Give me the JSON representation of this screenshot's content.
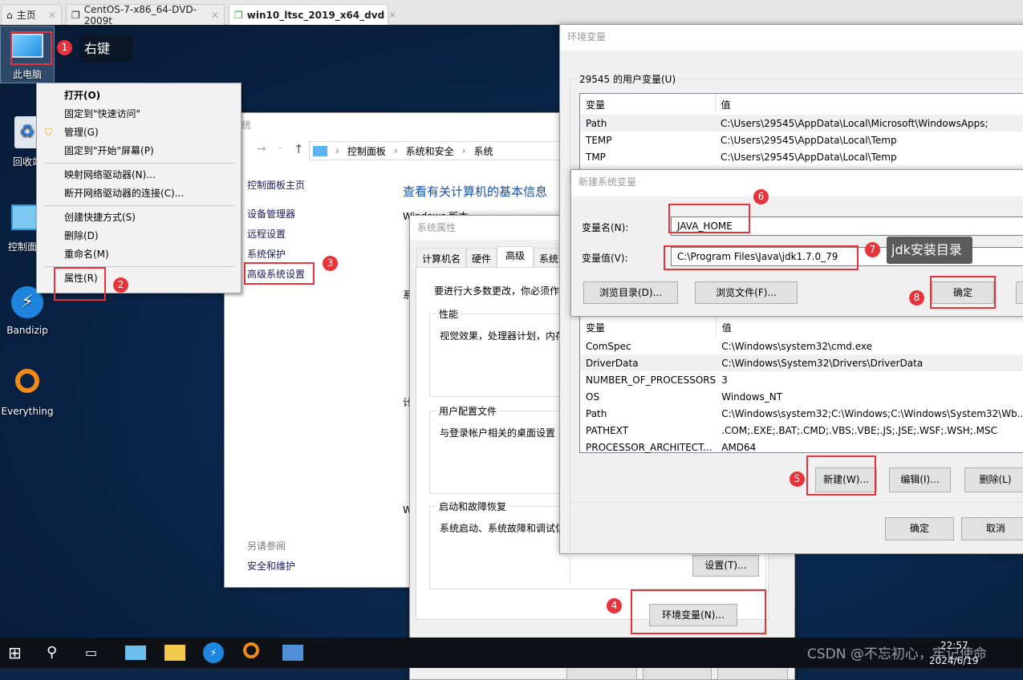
{
  "browser_tabs": [
    {
      "label": "主页",
      "icon": "home-icon"
    },
    {
      "label": "CentOS-7-x86_64-DVD-2009t",
      "icon": "vm-icon"
    },
    {
      "label": "win10_ltsc_2019_x64_dvd",
      "icon": "vm-running-icon",
      "active": true
    }
  ],
  "desktop_icons": [
    {
      "label": "此电脑",
      "icon": "computer-icon"
    },
    {
      "label": "回收站",
      "icon": "recycle-bin-icon"
    },
    {
      "label": "控制面板",
      "icon": "control-panel-icon"
    },
    {
      "label": "Bandizip",
      "icon": "bandizip-icon"
    },
    {
      "label": "Everything",
      "icon": "everything-icon"
    }
  ],
  "annotations": {
    "1": "1",
    "2": "2",
    "3": "3",
    "4": "4",
    "5": "5",
    "6": "6",
    "7": "7",
    "8": "8",
    "right_click_tip": "右键",
    "jdk_tip": "jdk安装目录",
    "color": "#e8333a"
  },
  "context_menu": {
    "items": [
      "打开(O)",
      "固定到\"快速访问\"",
      "管理(G)",
      "固定到\"开始\"屏幕(P)",
      "映射网络驱动器(N)...",
      "断开网络驱动器的连接(C)...",
      "创建快捷方式(S)",
      "删除(D)",
      "重命名(M)",
      "属性(R)"
    ]
  },
  "system_window": {
    "title": "系统",
    "breadcrumb": [
      "控制面板",
      "系统和安全",
      "系统"
    ],
    "sidebar": [
      "控制面板主页",
      "设备管理器",
      "远程设置",
      "系统保护",
      "高级系统设置"
    ],
    "heading": "查看有关计算机的基本信息",
    "windows_edition": "Windows 版本",
    "partial_labels": [
      "系",
      "计",
      "W"
    ],
    "see_also": "另请参阅",
    "see_also_link": "安全和维护"
  },
  "system_properties": {
    "title": "系统属性",
    "tabs": [
      "计算机名",
      "硬件",
      "高级",
      "系统"
    ],
    "active_tab": "高级",
    "notice": "要进行大多数更改，你必须作",
    "performance": {
      "label": "性能",
      "desc": "视觉效果，处理器计划，内存"
    },
    "user_profiles": {
      "label": "用户配置文件",
      "desc": "与登录帐户相关的桌面设置"
    },
    "startup": {
      "label": "启动和故障恢复",
      "desc": "系统启动、系统故障和调试信",
      "settings_button": "设置(T)..."
    },
    "env_button": "环境变量(N)..."
  },
  "env_dialog": {
    "title": "环境变量",
    "user_group": "29545 的用户变量(U)",
    "columns": [
      "变量",
      "值"
    ],
    "user_vars": [
      [
        "Path",
        "C:\\Users\\29545\\AppData\\Local\\Microsoft\\WindowsApps;"
      ],
      [
        "TEMP",
        "C:\\Users\\29545\\AppData\\Local\\Temp"
      ],
      [
        "TMP",
        "C:\\Users\\29545\\AppData\\Local\\Temp"
      ]
    ],
    "system_vars": [
      [
        "ComSpec",
        "C:\\Windows\\system32\\cmd.exe"
      ],
      [
        "DriverData",
        "C:\\Windows\\System32\\Drivers\\DriverData"
      ],
      [
        "NUMBER_OF_PROCESSORS",
        "3"
      ],
      [
        "OS",
        "Windows_NT"
      ],
      [
        "Path",
        "C:\\Windows\\system32;C:\\Windows;C:\\Windows\\System32\\Wb..."
      ],
      [
        "PATHEXT",
        ".COM;.EXE;.BAT;.CMD;.VBS;.VBE;.JS;.JSE;.WSF;.WSH;.MSC"
      ],
      [
        "PROCESSOR_ARCHITECT...",
        "AMD64"
      ]
    ],
    "new_button": "新建(W)...",
    "edit_button": "编辑(I)...",
    "delete_button": "删除(L)",
    "ok_button": "确定",
    "cancel_button": "取消"
  },
  "new_var_dialog": {
    "title": "新建系统变量",
    "name_label": "变量名(N):",
    "name_value": "JAVA_HOME",
    "value_label": "变量值(V):",
    "value_value": "C:\\Program Files\\Java\\jdk1.7.0_79",
    "browse_dir": "浏览目录(D)...",
    "browse_file": "浏览文件(F)...",
    "ok_button": "确定"
  },
  "taskbar": {
    "icons": [
      "start-icon",
      "search-icon",
      "task-view-icon",
      "control-panel-icon",
      "file-explorer-icon",
      "bandizip-icon",
      "everything-icon",
      "system-icon"
    ],
    "time": "22:57",
    "date": "2024/6/19"
  },
  "watermark": "CSDN @不忘初心，牢记使命"
}
